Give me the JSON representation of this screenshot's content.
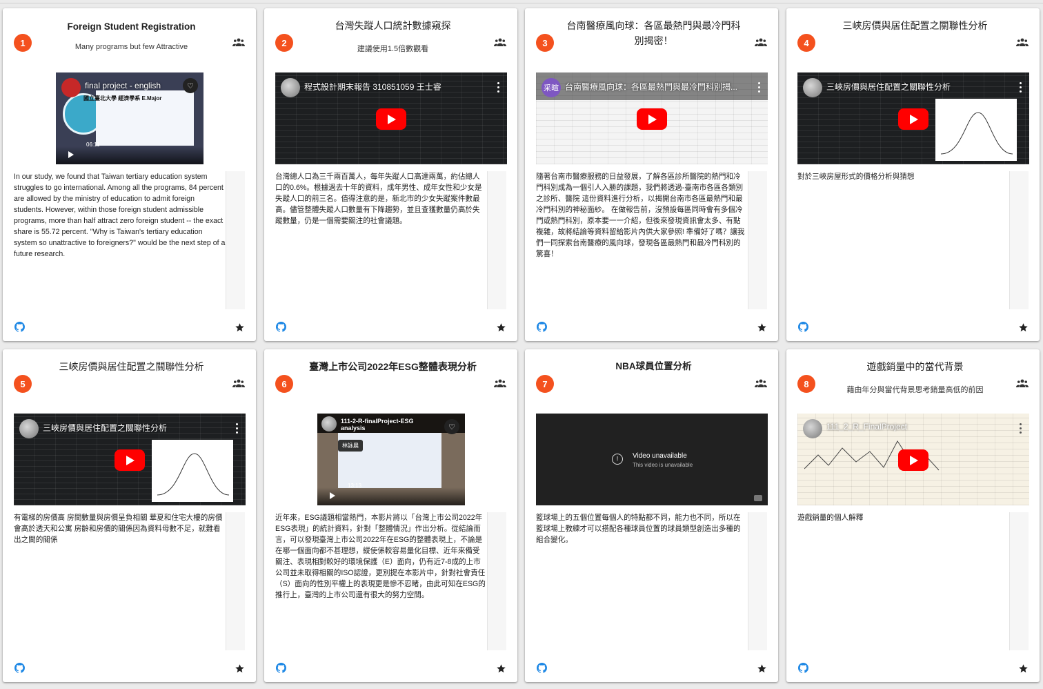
{
  "cards": [
    {
      "number": "1",
      "title": "Foreign Student Registration",
      "subtitle": "Many programs but few Attractive",
      "video_title": "final project - english",
      "video_overlay": "國立臺北大學 經濟學系 E.Major",
      "video_time": "06:11",
      "description": "In our study, we found that Taiwan tertiary education system struggles to go international. Among all the programs, 84 percent are allowed by the ministry of education to admit foreign students. However, within those foreign student admissible programs, more than half attract zero foreign student -- the exact share is 55.72 percent. \"Why is Taiwan's tertiary education system so unattractive to foreigners?\" would be the next step of a future research."
    },
    {
      "number": "2",
      "title": "台灣失蹤人口統計數據窺探",
      "subtitle": "建議使用1.5倍數觀看",
      "video_title": "程式設計期末報告 310851059 王士睿",
      "description": "台灣總人口為三千兩百萬人，每年失蹤人口高達兩萬，約佔總人口的0.6%。根據過去十年的資料，成年男性、成年女性和少女是失蹤人口的前三名。值得注意的是，新北市的少女失蹤案件數最高。儘管整體失蹤人口數量有下降趨勢，並且查獲數量仍高於失蹤數量，仍是一個需要關注的社會議題。"
    },
    {
      "number": "3",
      "title": "台南醫療風向球：各區最熱門與最冷門科別揭密！",
      "subtitle": "",
      "video_title": "台南醫療風向球：各區最熱門與最冷門科別揭...",
      "avatar_letter": "采暄",
      "description": "隨著台南市醫療服務的日益發展，了解各區診所醫院的熱門和冷門科別成為一個引人入勝的課題，我們將透過-臺南市各區各類別之診所、醫院 這份資料進行分析，以揭開台南市各區最熱門和最冷門科別的神秘面紗。 在做報告前，沒預設每區同時會有多個冷門或熱門科別，原本要一一介紹，但後來發現資訊會太多、有點複雜，故將結論等資料留給影片內供大家參照! 準備好了嗎？讓我們一同探索台南醫療的風向球，發現各區最熱門和最冷門科別的驚喜！"
    },
    {
      "number": "4",
      "title": "三峽房價與居住配置之關聯性分析",
      "subtitle": "",
      "video_title": "三峽房價與居住配置之關聯性分析",
      "description": "對於三峽房屋形式的價格分析與猜想"
    },
    {
      "number": "5",
      "title": "三峽房價與居住配置之關聯性分析",
      "subtitle": "",
      "video_title": "三峽房價與居住配置之關聯性分析",
      "description": "有電梯的房價高 房間數量與房價呈負相關 華夏和住宅大樓的房價會高於透天和公寓 房齡和房價的關係因為資料母數不足，就難看出之間的關係"
    },
    {
      "number": "6",
      "title": "臺灣上市公司2022年ESG整體表現分析",
      "subtitle": "",
      "video_title": "111-2-R-finalProject-ESG analysis",
      "video_pill": "林詠晨",
      "video_time": "13:13",
      "description": "近年來，ESG議題相當熱門，本影片將以「台灣上市公司2022年ESG表現」的統計資料，針對「整體情況」作出分析。從結論而言，可以發現臺灣上市公司2022年在ESG的整體表現上，不論是在哪一個面向都不甚理想，縱使係較容易量化目標、近年來備受關注、表現相對較好的環境保護（E）面向，仍有近7-8成的上市公司並未取得相關的ISO認證，更別提在本影片中，針對社會責任（S）面向的性別平權上的表現更是慘不忍睹，由此可知在ESG的推行上，臺灣的上市公司還有很大的努力空間。"
    },
    {
      "number": "7",
      "title": "NBA球員位置分析",
      "subtitle": "",
      "unavailable_title": "Video unavailable",
      "unavailable_sub": "This video is unavailable",
      "description": "籃球場上的五個位置每個人的特點都不同，能力也不同，所以在籃球場上教練才可以搭配各種球員位置的球員類型創造出多種的組合變化。"
    },
    {
      "number": "8",
      "title": "遊戲銷量中的當代背景",
      "subtitle": "藉由年分與當代背景思考銷量高低的前因",
      "video_title": "111_2_R_FinalProject",
      "description": "遊戲銷量的個人解釋"
    }
  ],
  "icons": {
    "group": "group-icon",
    "github": "github-icon",
    "star": "star-icon",
    "play": "play-icon"
  },
  "colors": {
    "badge": "#f4511e",
    "youtube_red": "#ff0000",
    "github_blue": "#1e88e5"
  }
}
